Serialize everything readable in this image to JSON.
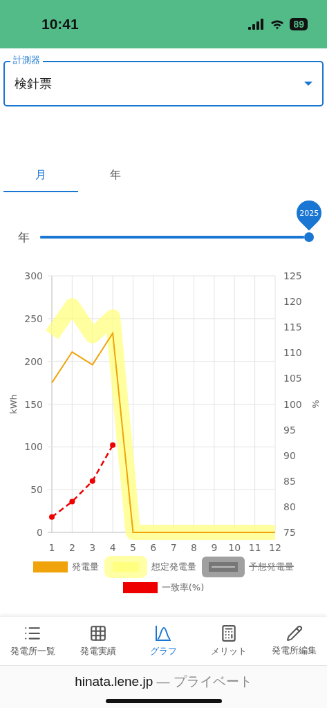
{
  "status_bar": {
    "time": "10:41",
    "battery": "89"
  },
  "meter_select": {
    "label": "計測器",
    "value": "検針票"
  },
  "tabs": [
    {
      "label": "月",
      "selected": true
    },
    {
      "label": "年",
      "selected": false
    }
  ],
  "year_slider": {
    "label": "年",
    "value": "2025",
    "level": 1
  },
  "chart": {
    "chart_data": {
      "type": "line",
      "grid": true,
      "ylabel": "kWh",
      "x": [
        1,
        2,
        3,
        4,
        5,
        6,
        7,
        8,
        9,
        10,
        11,
        12
      ],
      "xlim": [
        1,
        12
      ],
      "xticks": [
        1,
        2,
        3,
        4,
        5,
        6,
        7,
        8,
        9,
        10,
        11,
        12
      ],
      "ylim": [
        0,
        300
      ],
      "yticks": [
        0,
        50,
        100,
        150,
        200,
        250,
        300
      ],
      "y2label": "%",
      "y2lim": [
        75,
        125
      ],
      "y2ticks": [
        75,
        80,
        85,
        90,
        95,
        100,
        105,
        110,
        115,
        120,
        125
      ],
      "series": [
        {
          "name": "発電量",
          "color": "#f0a30a",
          "values": [
            175,
            211,
            196,
            233,
            0,
            0,
            0,
            0,
            0,
            0,
            0,
            0
          ]
        },
        {
          "name": "想定発電量",
          "color": "#ffff80",
          "values": [
            231,
            265,
            230,
            252,
            0,
            0,
            0,
            0,
            0,
            0,
            0,
            0
          ]
        },
        {
          "name": "予想発電量",
          "color": "#888888",
          "values": [
            null,
            null,
            null,
            null,
            null,
            null,
            null,
            null,
            null,
            null,
            null,
            null
          ]
        },
        {
          "name": "一致率(%)",
          "color": "#ee0000",
          "axis": "y2",
          "line_style": "dashed",
          "marker": "circle",
          "values": [
            78,
            81,
            85,
            92,
            null,
            null,
            null,
            null,
            null,
            null,
            null,
            null
          ]
        }
      ]
    },
    "legend": [
      {
        "kind": "line",
        "hidden": false
      },
      {
        "kind": "band",
        "hidden": false
      },
      {
        "kind": "band",
        "hidden": true
      },
      {
        "kind": "dashed",
        "hidden": false
      }
    ]
  },
  "bottom_nav": [
    {
      "label": "発電所一覧",
      "kind": "list",
      "selected": false
    },
    {
      "label": "発電実績",
      "kind": "table",
      "selected": false
    },
    {
      "label": "グラフ",
      "kind": "graph",
      "selected": true
    },
    {
      "label": "メリット",
      "kind": "calculator",
      "selected": false
    },
    {
      "label": "発電所編集",
      "kind": "pencil",
      "selected": false
    }
  ],
  "browser_bar": {
    "domain": "hinata.lene.jp",
    "note": "— プライベート"
  }
}
